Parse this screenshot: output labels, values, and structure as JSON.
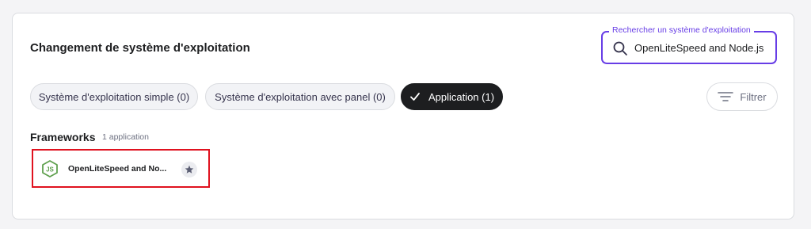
{
  "header": {
    "title": "Changement de système d'exploitation"
  },
  "search": {
    "label": "Rechercher un système d'exploitation",
    "value": "OpenLiteSpeed and Node.js",
    "icon": "search-icon"
  },
  "filters": {
    "chips": [
      {
        "label": "Système d'exploitation simple (0)",
        "active": false
      },
      {
        "label": "Système d'exploitation avec panel (0)",
        "active": false
      },
      {
        "label": "Application (1)",
        "active": true,
        "icon": "check-icon"
      }
    ],
    "filter_button": {
      "label": "Filtrer",
      "icon": "filter-icon"
    }
  },
  "section": {
    "title": "Frameworks",
    "count": "1 application",
    "apps": [
      {
        "name": "OpenLiteSpeed and No...",
        "icon": "nodejs-icon",
        "action_icon": "star-icon"
      }
    ]
  },
  "colors": {
    "accent": "#673de6",
    "highlight_border": "#e0121f",
    "active_chip": "#1d1e20",
    "node_green": "#5fa04e"
  }
}
